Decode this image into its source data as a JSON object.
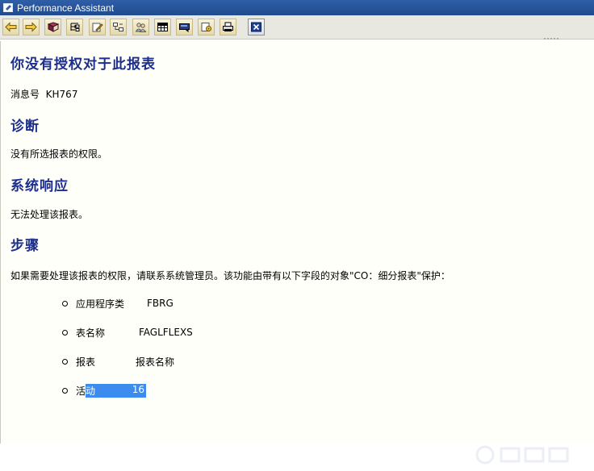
{
  "window": {
    "title": "Performance Assistant"
  },
  "toolbar": {
    "buttons": [
      {
        "name": "back-button",
        "icon": "arrow-left-icon"
      },
      {
        "name": "forward-button",
        "icon": "arrow-right-icon"
      },
      {
        "name": "glossary-button",
        "icon": "book-icon"
      },
      {
        "name": "technical-info-button",
        "icon": "tree-icon"
      },
      {
        "name": "edit-button",
        "icon": "pencil-icon"
      },
      {
        "name": "help-button",
        "icon": "flow-icon"
      },
      {
        "name": "people-button",
        "icon": "people-icon"
      },
      {
        "name": "table-button",
        "icon": "table-icon"
      },
      {
        "name": "message-button",
        "icon": "message-icon"
      },
      {
        "name": "settings-button",
        "icon": "gear-icon"
      },
      {
        "name": "print-button",
        "icon": "printer-icon"
      },
      {
        "name": "close-button",
        "icon": "close-icon"
      }
    ]
  },
  "content": {
    "title": "你没有授权对于此报表",
    "message_no_label": "消息号",
    "message_no": "KH767",
    "diagnosis_heading": "诊断",
    "diagnosis_text": "没有所选报表的权限。",
    "system_response_heading": "系统响应",
    "system_response_text": "无法处理该报表。",
    "procedure_heading": "步骤",
    "procedure_text": "如果需要处理该报表的权限，请联系系统管理员。该功能由带有以下字段的对象\"CO：细分报表\"保护：",
    "fields": [
      {
        "label": "应用程序类",
        "value": "FBRG"
      },
      {
        "label": "表名称",
        "value": "FAGLFLEXS"
      },
      {
        "label": "报表",
        "value": "报表名称"
      },
      {
        "label_plain": "活",
        "label_highlight": "动",
        "value": "16"
      }
    ]
  },
  "colors": {
    "heading": "#1c2e8a",
    "highlight": "#3c8cf0",
    "titlebar": "#2f5fa7"
  }
}
